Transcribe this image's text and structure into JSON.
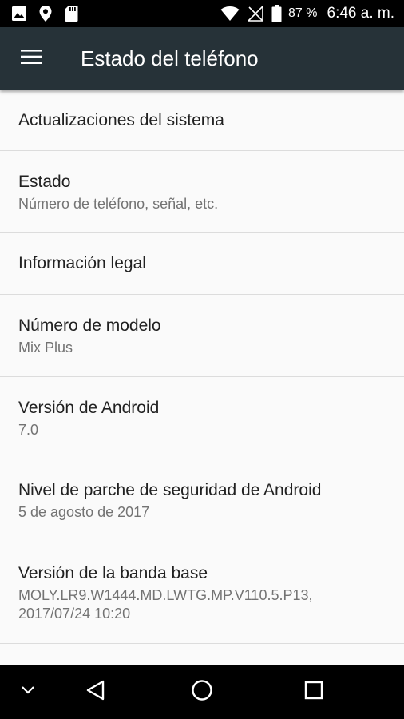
{
  "status_bar": {
    "battery_percent": "87 %",
    "time": "6:46 a. m.",
    "icons": [
      "image-icon",
      "location-icon",
      "sd-card-icon",
      "wifi-icon",
      "no-signal-icon",
      "battery-icon"
    ]
  },
  "app_bar": {
    "title": "Estado del teléfono",
    "menu_icon": "menu-icon"
  },
  "items": [
    {
      "title": "Actualizaciones del sistema"
    },
    {
      "title": "Estado",
      "summary": "Número de teléfono, señal, etc."
    },
    {
      "title": "Información legal"
    },
    {
      "title": "Número de modelo",
      "summary": "Mix Plus"
    },
    {
      "title": "Versión de Android",
      "summary": "7.0"
    },
    {
      "title": "Nivel de parche de seguridad de Android",
      "summary": "5 de agosto de 2017"
    },
    {
      "title": "Versión de la banda base",
      "summary": "MOLY.LR9.W1444.MD.LWTG.MP.V110.5.P13, 2017/07/24 10:20"
    }
  ],
  "nav_bar": {
    "icons": [
      "hide-keyboard-icon",
      "back-icon",
      "home-icon",
      "recents-icon"
    ]
  }
}
